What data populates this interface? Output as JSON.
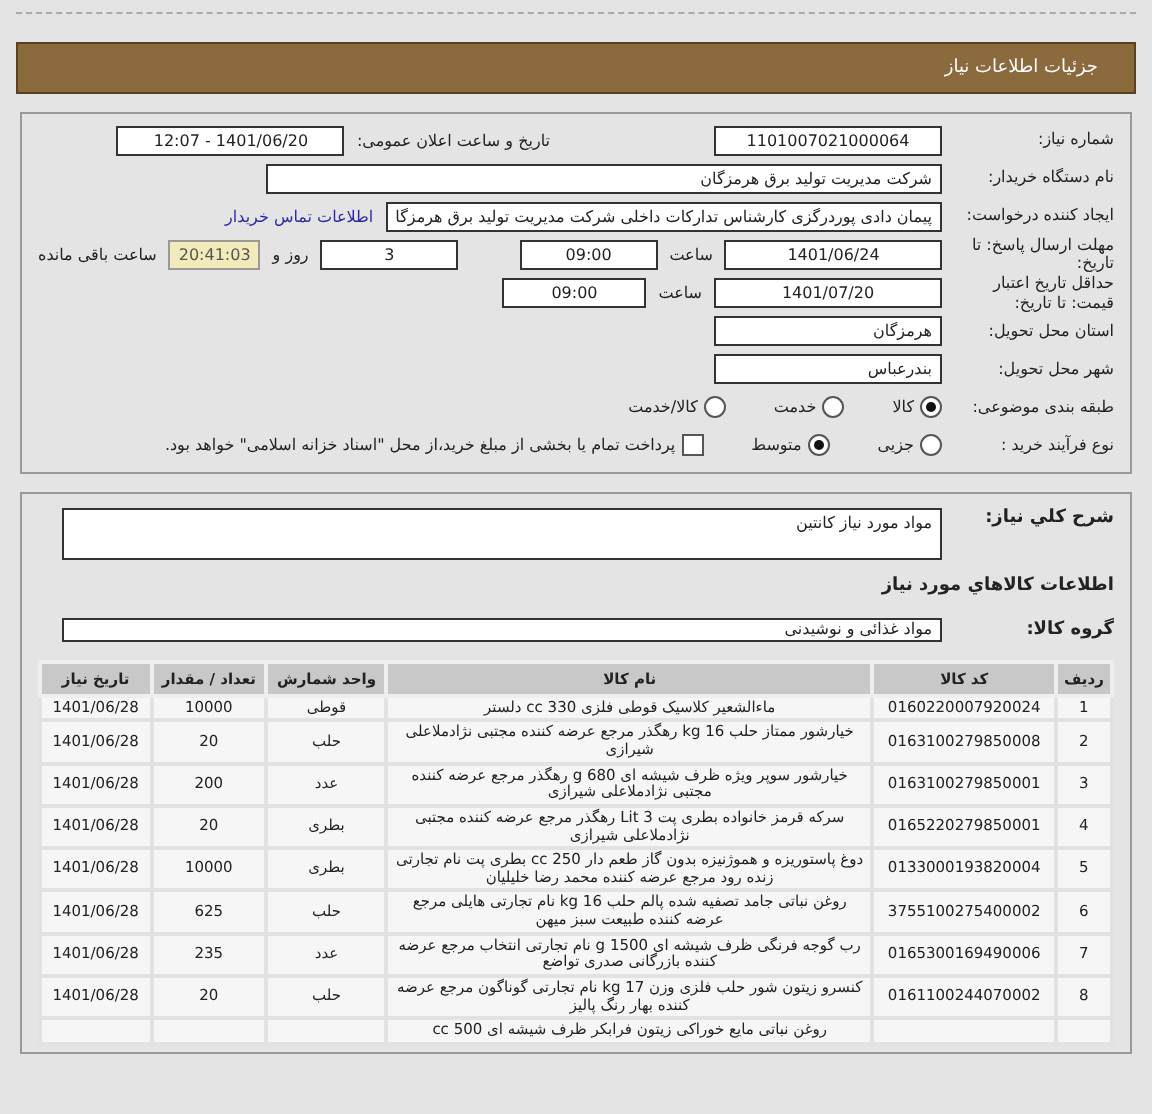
{
  "header": {
    "title": "جزئیات اطلاعات نیاز"
  },
  "need_number": {
    "label": "شماره نیاز:",
    "value": "1101007021000064"
  },
  "announce": {
    "label": "تاریخ و ساعت اعلان عمومی:",
    "value": "1401/06/20 - 12:07"
  },
  "buyer": {
    "label": "نام دستگاه خریدار:",
    "value": "شرکت مدیریت تولید برق هرمزگان"
  },
  "creator": {
    "label": "ایجاد کننده درخواست:",
    "value": "پیمان دادی پوردرگزی کارشناس تدارکات داخلی شرکت مدیریت تولید برق هرمزگا",
    "link": "اطلاعات تماس خریدار"
  },
  "deadline": {
    "label": "مهلت ارسال پاسخ: تا تاریخ:",
    "date": "1401/06/24",
    "time_label": "ساعت",
    "time": "09:00",
    "days": "3",
    "days_label": "روز و",
    "remaining": "20:41:03",
    "remaining_label": "ساعت باقی مانده"
  },
  "validity": {
    "label": "حداقل تاریخ اعتبار قیمت: تا تاریخ:",
    "date": "1401/07/20",
    "time_label": "ساعت",
    "time": "09:00"
  },
  "province": {
    "label": "استان محل تحویل:",
    "value": "هرمزگان"
  },
  "city": {
    "label": "شهر محل تحویل:",
    "value": "بندرعباس"
  },
  "category": {
    "label": "طبقه بندی موضوعی:",
    "options": [
      {
        "label": "کالا",
        "selected": true
      },
      {
        "label": "خدمت",
        "selected": false
      },
      {
        "label": "کالا/خدمت",
        "selected": false
      }
    ]
  },
  "process": {
    "label": "نوع فرآیند خرید :",
    "options": [
      {
        "label": "جزیی",
        "selected": false
      },
      {
        "label": "متوسط",
        "selected": true
      }
    ],
    "payment": {
      "checked": false,
      "text": "پرداخت تمام یا بخشی از مبلغ خرید،از محل \"اسناد خزانه اسلامی\" خواهد بود."
    }
  },
  "description": {
    "label": "شرح کلي نياز:",
    "value": "مواد مورد نياز كانتين"
  },
  "goods_title": "اطلاعات كالاهاي مورد نياز",
  "goods_group": {
    "label": "گروه كالا:",
    "value": "مواد غذائی و نوشیدنی"
  },
  "table": {
    "columns": [
      "ردیف",
      "کد کالا",
      "نام کالا",
      "واحد شمارش",
      "تعداد / مقدار",
      "تاریخ نیاز"
    ],
    "rows": [
      [
        "1",
        "0160220007920024",
        "ماءالشعیر کلاسیک قوطی فلزی 330 cc دلستر",
        "قوطی",
        "10000",
        "1401/06/28"
      ],
      [
        "2",
        "0163100279850008",
        "خیارشور ممتاز حلب 16 kg رهگذر مرجع عرضه کننده مجتبی نژادملاعلی شیرازی",
        "حلب",
        "20",
        "1401/06/28"
      ],
      [
        "3",
        "0163100279850001",
        "خیارشور سوپر ویژه ظرف شیشه ای 680 g رهگذر مرجع عرضه کننده مجتبی نژادملاعلی شیرازی",
        "عدد",
        "200",
        "1401/06/28"
      ],
      [
        "4",
        "0165220279850001",
        "سرکه قرمز خانواده بطری پت 3 Lit رهگذر مرجع عرضه کننده مجتبی نژادملاعلی شیرازی",
        "بطری",
        "20",
        "1401/06/28"
      ],
      [
        "5",
        "0133000193820004",
        "دوغ پاستوریزه و هموژنیزه بدون گاز طعم دار 250 cc بطری پت نام تجارتی زنده رود مرجع عرضه کننده محمد رضا خلیلیان",
        "بطری",
        "10000",
        "1401/06/28"
      ],
      [
        "6",
        "3755100275400002",
        "روغن نباتی جامد تصفیه شده پالم حلب 16 kg نام تجارتی هایلی مرجع عرضه کننده طبیعت سبز میهن",
        "حلب",
        "625",
        "1401/06/28"
      ],
      [
        "7",
        "0165300169490006",
        "رب گوجه فرنگی ظرف شیشه ای 1500 g نام تجارتی انتخاب مرجع عرضه کننده بازرگانی صدری تواضع",
        "عدد",
        "235",
        "1401/06/28"
      ],
      [
        "8",
        "0161100244070002",
        "کنسرو زیتون شور حلب فلزی وزن 17 kg نام تجارتی گوناگون مرجع عرضه کننده بهار رنگ پالیز",
        "حلب",
        "20",
        "1401/06/28"
      ],
      [
        "",
        "",
        "روغن نباتی مایع خوراکی زیتون فرابکر ظرف شیشه ای cc 500",
        "",
        "",
        ""
      ]
    ]
  }
}
